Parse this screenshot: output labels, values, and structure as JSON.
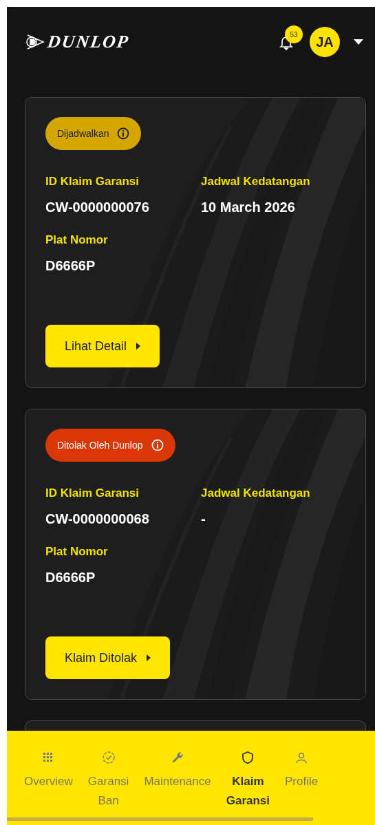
{
  "header": {
    "logo": "DUNLOP",
    "notification_count": "53",
    "avatar_initials": "JA"
  },
  "claims": [
    {
      "status": {
        "label": "Dijadwalkan",
        "kind": "scheduled",
        "color": "#d4a600"
      },
      "id_label": "ID Klaim Garansi",
      "id_value": "CW-0000000076",
      "schedule_label": "Jadwal Kedatangan",
      "schedule_value": "10 March 2026",
      "plate_label": "Plat Nomor",
      "plate_value": "D6666P",
      "action": "Lihat Detail"
    },
    {
      "status": {
        "label": "Ditolak Oleh Dunlop",
        "kind": "rejected",
        "color": "#d93706"
      },
      "id_label": "ID Klaim Garansi",
      "id_value": "CW-0000000068",
      "schedule_label": "Jadwal Kedatangan",
      "schedule_value": "-",
      "plate_label": "Plat Nomor",
      "plate_value": "D6666P",
      "action": "Klaim Ditolak"
    }
  ],
  "bottom_nav": [
    {
      "label": "Overview",
      "selected": false
    },
    {
      "label": "Garansi Ban",
      "selected": false
    },
    {
      "label": "Maintenance",
      "selected": false
    },
    {
      "label": "Klaim Garansi",
      "selected": true
    },
    {
      "label": "Profile",
      "selected": false
    }
  ]
}
